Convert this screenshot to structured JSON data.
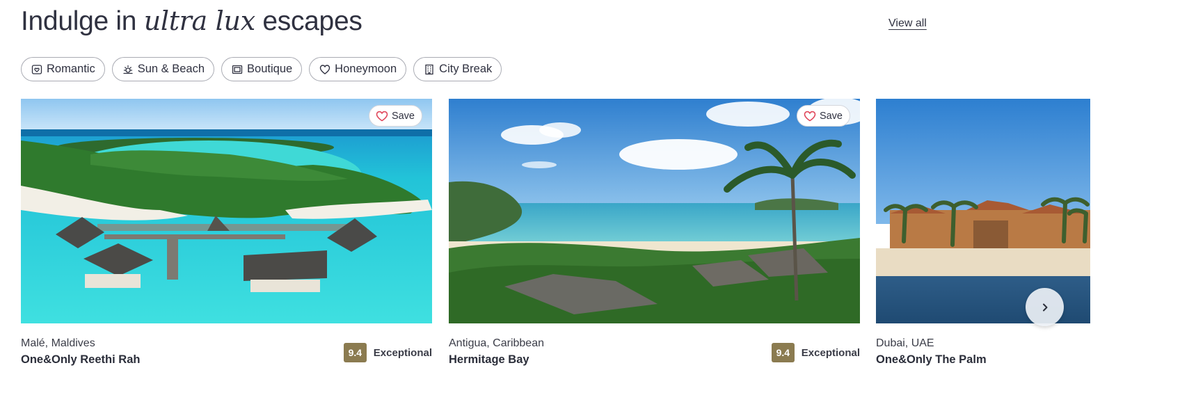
{
  "header": {
    "title_before": "Indulge in ",
    "title_emphasis": "ultra lux",
    "title_after": " escapes",
    "view_all_label": "View all"
  },
  "filters": [
    {
      "label": "Romantic",
      "icon": "romantic-icon"
    },
    {
      "label": "Sun & Beach",
      "icon": "sun-icon"
    },
    {
      "label": "Boutique",
      "icon": "boutique-icon"
    },
    {
      "label": "Honeymoon",
      "icon": "heart-icon"
    },
    {
      "label": "City Break",
      "icon": "building-icon"
    }
  ],
  "cards": [
    {
      "location": "Malé, Maldives",
      "name": "One&Only Reethi Rah",
      "score": "9.4",
      "score_label": "Exceptional",
      "save_label": "Save"
    },
    {
      "location": "Antigua, Caribbean",
      "name": "Hermitage Bay",
      "score": "9.4",
      "score_label": "Exceptional",
      "save_label": "Save"
    },
    {
      "location": "Dubai, UAE",
      "name": "One&Only The Palm"
    }
  ],
  "colors": {
    "score_badge": "#8b7b50",
    "save_heart": "#e0465a",
    "text": "#2f3140"
  }
}
